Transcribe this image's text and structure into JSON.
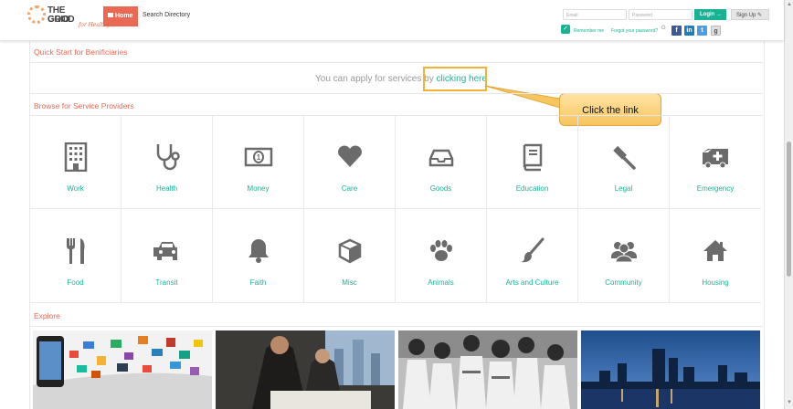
{
  "header": {
    "logo": {
      "line1": "THE GOOD",
      "line2": "GRID",
      "tagline": "for Healthy"
    },
    "home_label": "Home",
    "search_directory_label": "Search Directory",
    "email_placeholder": "Email",
    "password_placeholder": "Password",
    "login_label": "Login",
    "signup_label": "Sign Up",
    "remember_me_label": "Remember me",
    "forgot_password_label": "Forgot your password?",
    "social": {
      "facebook": "f",
      "linkedin": "in",
      "twitter": "t",
      "google": "g"
    }
  },
  "quick_start": {
    "title": "Quick Start for Benificiaries",
    "apply_text": "You can apply for services by",
    "apply_link": "clicking here"
  },
  "callout": {
    "text": "Click the link"
  },
  "browse": {
    "title": "Browse for Service Providers",
    "categories": [
      {
        "label": "Work",
        "icon": "building-icon"
      },
      {
        "label": "Health",
        "icon": "stethoscope-icon"
      },
      {
        "label": "Money",
        "icon": "money-bill-icon"
      },
      {
        "label": "Care",
        "icon": "heart-icon"
      },
      {
        "label": "Goods",
        "icon": "inbox-tray-icon"
      },
      {
        "label": "Education",
        "icon": "book-icon"
      },
      {
        "label": "Legal",
        "icon": "gavel-icon"
      },
      {
        "label": "Emergency",
        "icon": "ambulance-icon"
      },
      {
        "label": "Food",
        "icon": "cutlery-icon"
      },
      {
        "label": "Transit",
        "icon": "car-icon"
      },
      {
        "label": "Faith",
        "icon": "bell-icon"
      },
      {
        "label": "Misc",
        "icon": "cube-icon"
      },
      {
        "label": "Animals",
        "icon": "paw-icon"
      },
      {
        "label": "Arts and Culture",
        "icon": "paintbrush-icon"
      },
      {
        "label": "Community",
        "icon": "users-icon"
      },
      {
        "label": "Housing",
        "icon": "house-icon"
      }
    ]
  },
  "explore": {
    "title": "Explore"
  },
  "colors": {
    "accent": "#19b394",
    "brand": "#ea6954",
    "callout": "#f8c55f",
    "icon": "#6b6b6b"
  }
}
